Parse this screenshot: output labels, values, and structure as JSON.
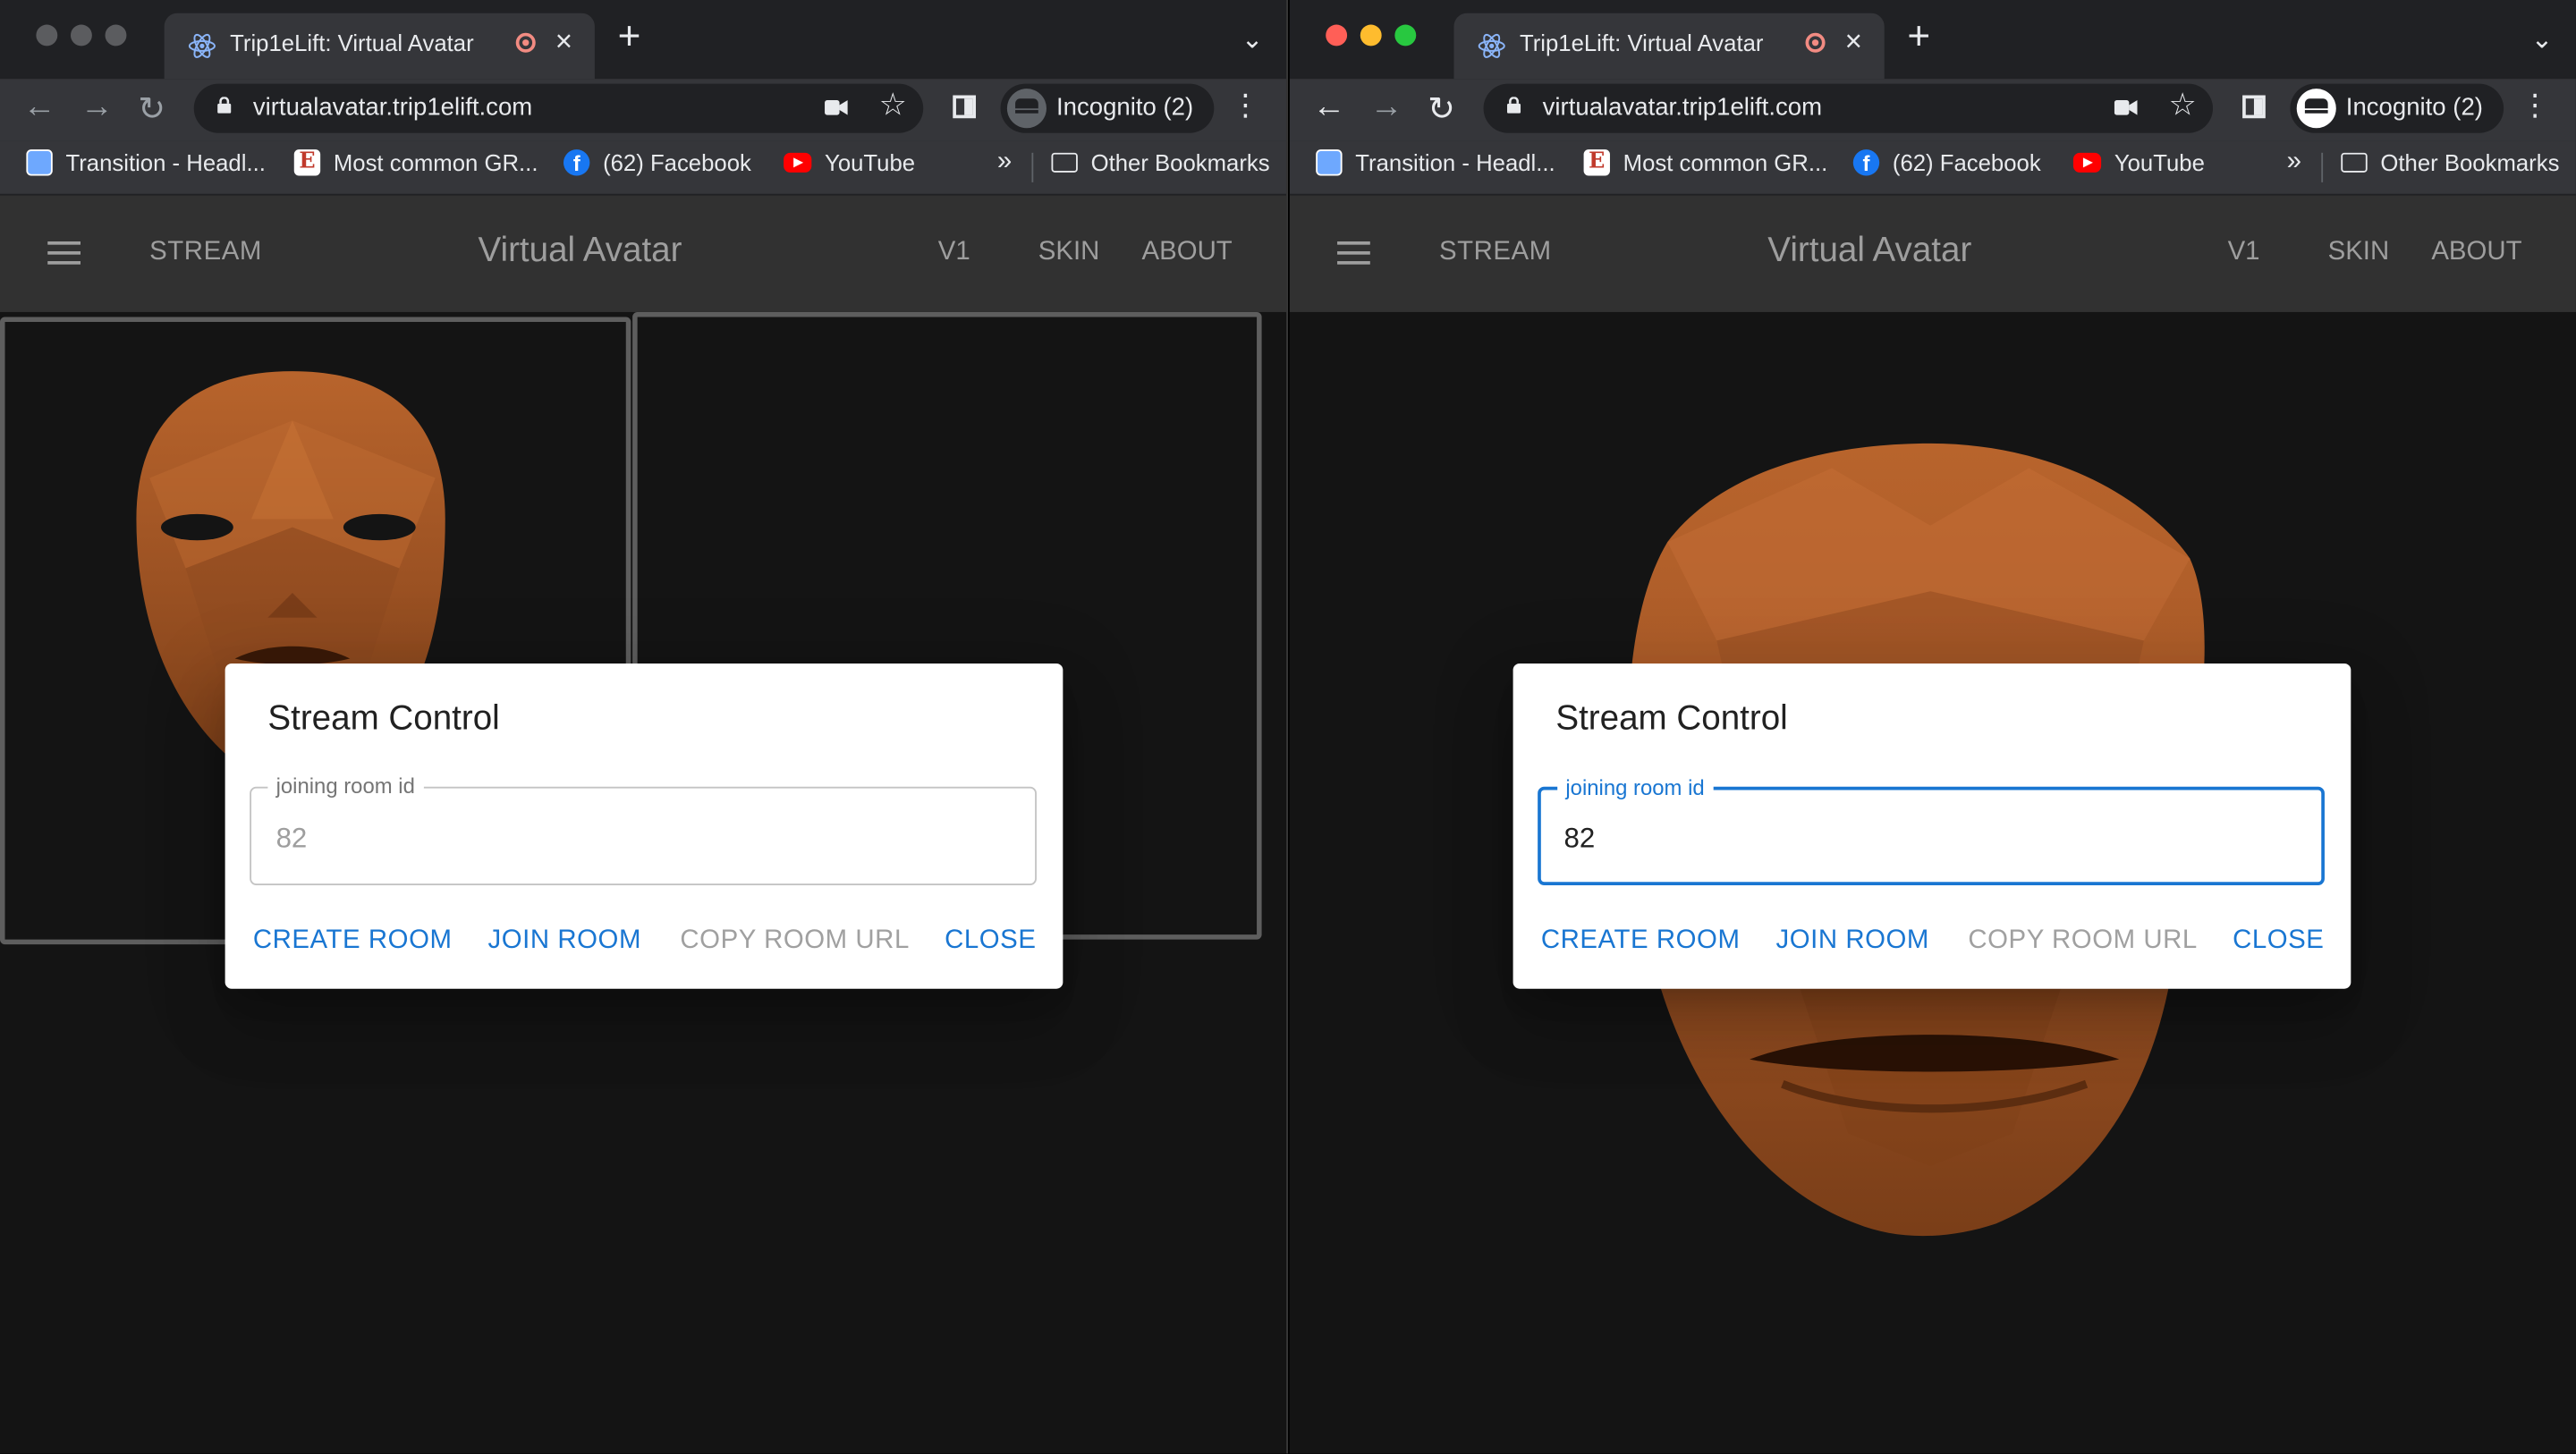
{
  "windows": [
    {
      "id": "left",
      "tab": {
        "title": "Trip1eLift: Virtual Avatar"
      },
      "url": "virtualavatar.trip1elift.com",
      "profile": "Incognito (2)",
      "bookmarks": [
        "Transition - Headl...",
        "Most common GR...",
        "(62) Facebook",
        "YouTube"
      ],
      "bookmarks_more": "»",
      "other_bookmarks": "Other Bookmarks",
      "app": {
        "stream": "STREAM",
        "brand": "Virtual Avatar",
        "v1": "V1",
        "skin": "SKIN",
        "about": "ABOUT"
      },
      "dialog": {
        "title": "Stream Control",
        "field_label": "joining room id",
        "field_value": "82",
        "buttons": {
          "create": "CREATE ROOM",
          "join": "JOIN ROOM",
          "copy": "COPY ROOM URL",
          "close": "CLOSE"
        }
      }
    },
    {
      "id": "right",
      "tab": {
        "title": "Trip1eLift: Virtual Avatar"
      },
      "url": "virtualavatar.trip1elift.com",
      "profile": "Incognito (2)",
      "bookmarks": [
        "Transition - Headl...",
        "Most common GR...",
        "(62) Facebook",
        "YouTube"
      ],
      "bookmarks_more": "»",
      "other_bookmarks": "Other Bookmarks",
      "app": {
        "stream": "STREAM",
        "brand": "Virtual Avatar",
        "v1": "V1",
        "skin": "SKIN",
        "about": "ABOUT"
      },
      "dialog": {
        "title": "Stream Control",
        "field_label": "joining room id",
        "field_value": "82",
        "buttons": {
          "create": "CREATE ROOM",
          "join": "JOIN ROOM",
          "copy": "COPY ROOM URL",
          "close": "CLOSE"
        }
      }
    }
  ],
  "colors": {
    "accent": "#1976d2",
    "disabled": "#a0a0a0",
    "mask": "#b0602a"
  },
  "icons": [
    "react-favicon",
    "recording-indicator",
    "lock-icon",
    "camera-icon",
    "star-icon",
    "incognito-icon",
    "hamburger-icon",
    "folder-icon"
  ]
}
